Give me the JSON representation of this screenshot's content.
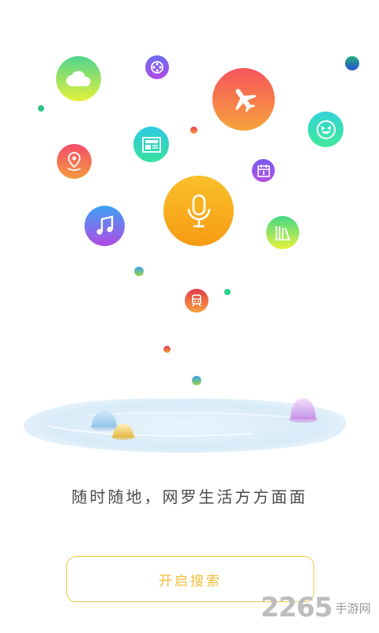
{
  "tagline": "随时随地，网罗生活方方面面",
  "start_button": {
    "label": "开启搜索"
  },
  "watermark": {
    "number": "2265",
    "suffix": "手游网"
  },
  "icons": [
    "cloud-icon",
    "film-reel-icon",
    "airplane-icon",
    "smile-icon",
    "news-icon",
    "location-pin-icon",
    "calendar-icon",
    "microphone-icon",
    "music-note-icon",
    "books-icon",
    "train-icon"
  ],
  "colors": {
    "accent": "#f6b51a",
    "button_border": "#f2c84b",
    "button_text": "#f1be3a",
    "tagline_text": "#4a4a4a"
  }
}
